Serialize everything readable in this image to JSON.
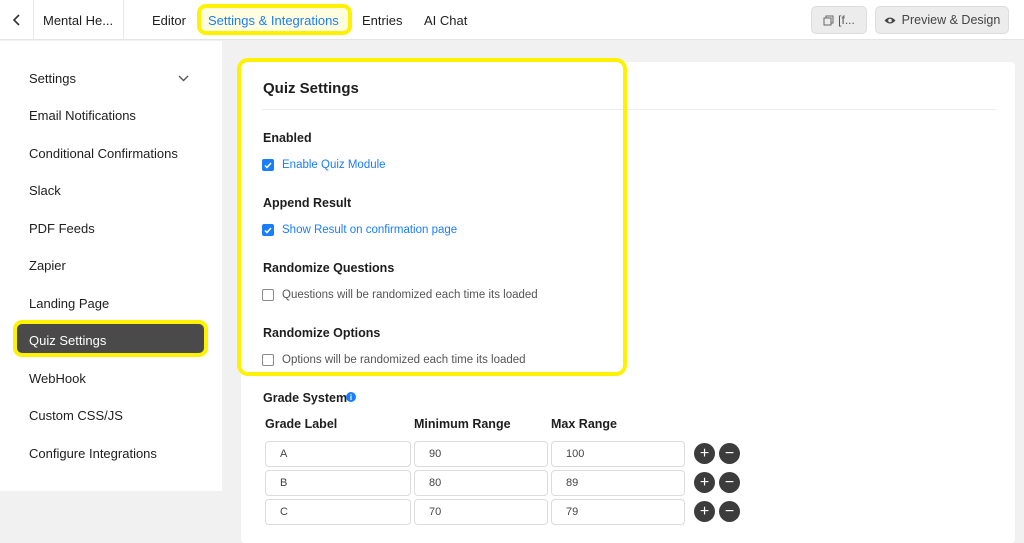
{
  "topbar": {
    "back_icon": "chevron-left-icon",
    "form_name": "Mental He...",
    "tabs": [
      {
        "label": "Editor"
      },
      {
        "label": "Settings & Integrations"
      },
      {
        "label": "Entries"
      },
      {
        "label": "AI Chat"
      }
    ],
    "doc_button_label": "[f...",
    "preview_label": "Preview & Design",
    "accent": "#1a7efb"
  },
  "sidebar": {
    "items": [
      {
        "label": "Settings"
      },
      {
        "label": "Email Notifications"
      },
      {
        "label": "Conditional Confirmations"
      },
      {
        "label": "Slack"
      },
      {
        "label": "PDF Feeds"
      },
      {
        "label": "Zapier"
      },
      {
        "label": "Landing Page"
      },
      {
        "label": "Quiz Settings"
      },
      {
        "label": "WebHook"
      },
      {
        "label": "Custom CSS/JS"
      },
      {
        "label": "Configure Integrations"
      }
    ],
    "active_item": "Quiz Settings"
  },
  "quiz": {
    "title": "Quiz Settings",
    "enabled": {
      "label": "Enabled",
      "option": "Enable Quiz Module",
      "checked": true
    },
    "append": {
      "label": "Append Result",
      "option": "Show Result on confirmation page",
      "checked": true
    },
    "rand_questions": {
      "label": "Randomize Questions",
      "option": "Questions will be randomized each time its loaded",
      "checked": false
    },
    "rand_options": {
      "label": "Randomize Options",
      "option": "Options will be randomized each time its loaded",
      "checked": false
    },
    "grade": {
      "title": "Grade System",
      "headers": {
        "label": "Grade Label",
        "min": "Minimum Range",
        "max": "Max Range"
      },
      "rows": [
        {
          "label": "A",
          "min": "90",
          "max": "100"
        },
        {
          "label": "B",
          "min": "80",
          "max": "89"
        },
        {
          "label": "C",
          "min": "70",
          "max": "79"
        }
      ]
    }
  },
  "highlight_color": "#fff200"
}
